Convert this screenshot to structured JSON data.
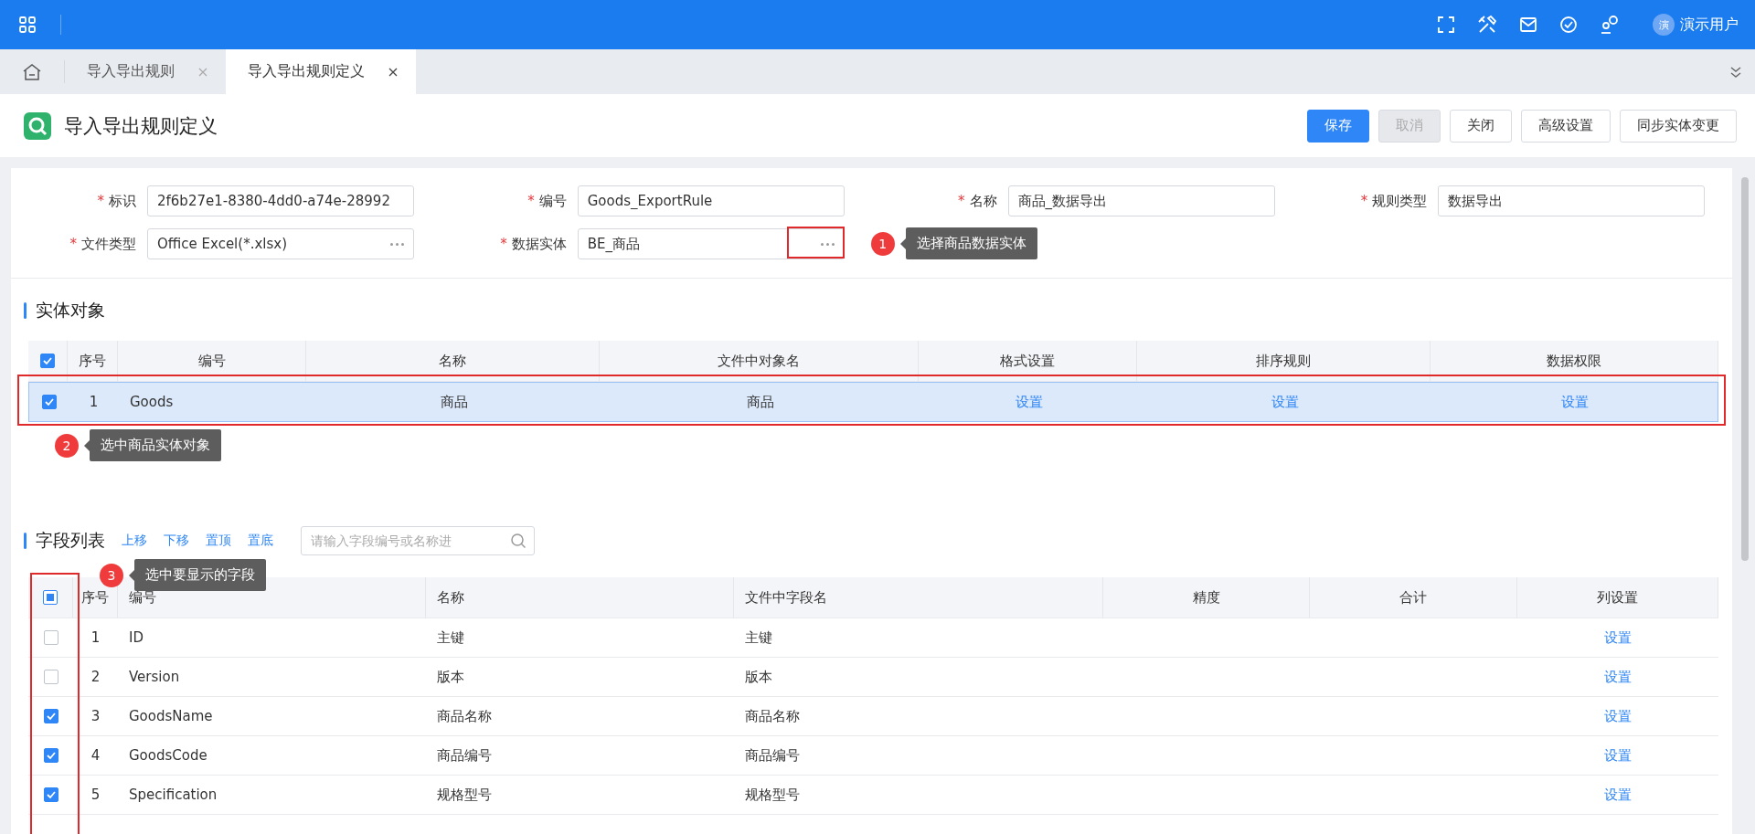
{
  "top_bar": {
    "user_avatar": "演",
    "user_name": "演示用户"
  },
  "tabs": [
    {
      "label": "导入导出规则",
      "selected": false
    },
    {
      "label": "导入导出规则定义",
      "selected": true
    }
  ],
  "page": {
    "title": "导入导出规则定义",
    "buttons": [
      {
        "label": "保存",
        "kind": "primary",
        "disabled": false
      },
      {
        "label": "取消",
        "kind": "default",
        "disabled": true
      },
      {
        "label": "关闭",
        "kind": "default",
        "disabled": false
      },
      {
        "label": "高级设置",
        "kind": "default",
        "disabled": false
      },
      {
        "label": "同步实体变更",
        "kind": "default",
        "disabled": false
      }
    ]
  },
  "form": {
    "required_mark": "*",
    "fields": [
      {
        "label": "标识",
        "required": true,
        "value": "2f6b27e1-8380-4dd0-a74e-28992",
        "lookup": false,
        "highlighted": false
      },
      {
        "label": "编号",
        "required": true,
        "value": "Goods_ExportRule",
        "lookup": false,
        "highlighted": false
      },
      {
        "label": "名称",
        "required": true,
        "value": "商品_数据导出",
        "lookup": false,
        "highlighted": false
      },
      {
        "label": "规则类型",
        "required": true,
        "value": "数据导出",
        "lookup": false,
        "highlighted": false
      },
      {
        "label": "文件类型",
        "required": true,
        "value": "Office Excel(*.xlsx)",
        "lookup": true,
        "highlighted": false
      },
      {
        "label": "数据实体",
        "required": true,
        "value": "BE_商品",
        "lookup": true,
        "highlighted": true,
        "callout": {
          "number": "1",
          "text": "选择商品数据实体"
        }
      }
    ]
  },
  "entity_section": {
    "title": "实体对象",
    "all_checked": true,
    "columns": [
      "序号",
      "编号",
      "名称",
      "文件中对象名",
      "格式设置",
      "排序规则",
      "数据权限"
    ],
    "rows": [
      {
        "checked": true,
        "selected": true,
        "highlighted": true,
        "index": "1",
        "code": "Goods",
        "name": "商品",
        "file_name": "商品",
        "format": "设置",
        "sort": "设置",
        "permission": "设置"
      }
    ],
    "callout": {
      "number": "2",
      "text": "选中商品实体对象"
    }
  },
  "field_section": {
    "title": "字段列表",
    "actions": [
      "上移",
      "下移",
      "置顶",
      "置底"
    ],
    "search": {
      "placeholder": "请输入字段编号或名称进"
    },
    "select_all_partial": true,
    "checkbox_column_highlighted": true,
    "callout": {
      "number": "3",
      "text": "选中要显示的字段"
    },
    "columns": [
      "序号",
      "编号",
      "名称",
      "文件中字段名",
      "精度",
      "合计",
      "列设置"
    ],
    "rows": [
      {
        "checked": false,
        "index": "1",
        "code": "ID",
        "name": "主键",
        "file_name": "主键",
        "setting": "设置"
      },
      {
        "checked": false,
        "index": "2",
        "code": "Version",
        "name": "版本",
        "file_name": "版本",
        "setting": "设置"
      },
      {
        "checked": true,
        "index": "3",
        "code": "GoodsName",
        "name": "商品名称",
        "file_name": "商品名称",
        "setting": "设置"
      },
      {
        "checked": true,
        "index": "4",
        "code": "GoodsCode",
        "name": "商品编号",
        "file_name": "商品编号",
        "setting": "设置"
      },
      {
        "checked": true,
        "index": "5",
        "code": "Specification",
        "name": "规格型号",
        "file_name": "规格型号",
        "setting": "设置"
      }
    ]
  }
}
